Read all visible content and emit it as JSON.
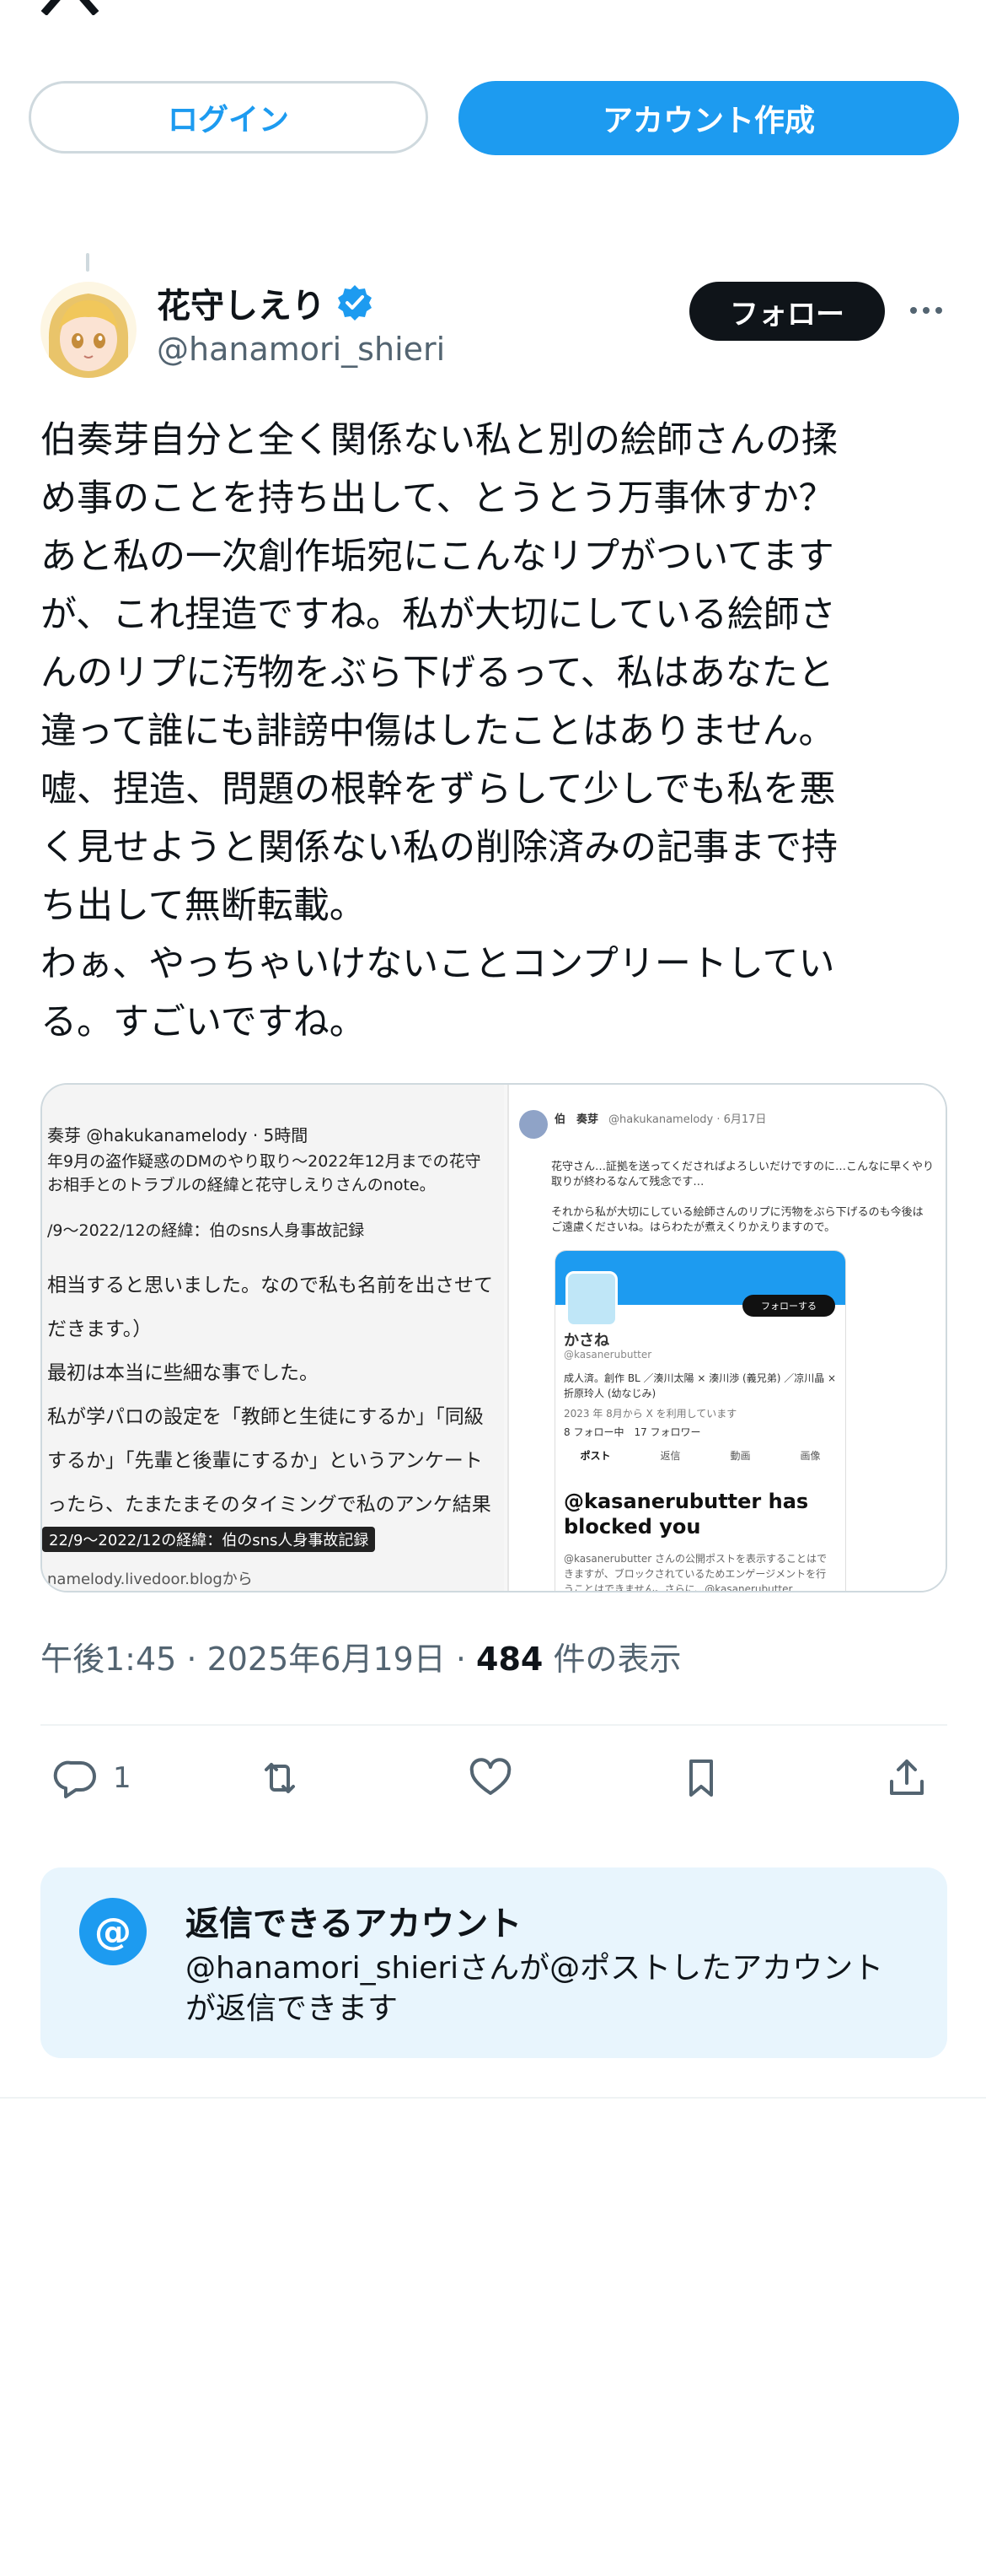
{
  "header": {
    "login_label": "ログイン",
    "create_account_label": "アカウント作成"
  },
  "tweet": {
    "display_name": "花守しえり",
    "handle": "@hanamori_shieri",
    "follow_label": "フォロー",
    "text": "伯奏芽自分と全く関係ない私と別の絵師さんの揉\nめ事のことを持ち出して、とうとう万事休すか？\nあと私の一次創作垢宛にこんなリプがついてます\nが、これ捏造ですね。私が大切にしている絵師さ\nんのリプに汚物をぶら下げるって、私はあなたと\n違って誰にも誹謗中傷はしたことはありません。\n嘘、捏造、問題の根幹をずらして少しでも私を悪\nく見せようと関係ない私の削除済みの記事まで持\nち出して無断転載。\nわぁ、やっちゃいけないことコンプリートしてい\nる。すごいですね。",
    "time": "午後1:45 · 2025年6月19日 · ",
    "views_count": "484",
    "views_label": " 件の表示",
    "reply_count": "1"
  },
  "media": {
    "left": {
      "header": "奏芽 @hakukanamelody · 5時間",
      "line1": "年9月の盗作疑惑のDMのやり取り～2022年12月までの花守",
      "line2": "お相手とのトラブルの経緯と花守しえりさんのnote。",
      "line3": "/9～2022/12の経緯：伯のsns人身事故記録",
      "body1": "相当すると思いました。なので私も名前を出させて",
      "body2": "だきます。）",
      "body3": "最初は本当に些細な事でした。",
      "body4": "私が学パロの設定を「教師と生徒にするか」「同級",
      "body5": "するか」「先輩と後輩にするか」というアンケート",
      "body6": "ったら、たまたまそのタイミングで私のアンケ結果",
      "caption": "22/9～2022/12の経緯：伯のsns人身事故記録",
      "source": "namelody.livedoor.blogから"
    },
    "right": {
      "header_name": "伯　奏芽",
      "header_handle": "@hakukanamelody · 6月17日",
      "reply_line1": "花守さん…証拠を送ってくださればよろしいだけですのに…こんなに早くやり",
      "reply_line2": "取りが終わるなんて残念です…",
      "reply_line3": "それから私が大切にしている絵師さんのリプに汚物をぶら下げるのも今後は",
      "reply_line4": "ご遠慮くださいね。はらわたが煮えくりかえりますので。",
      "card_follow": "フォローする",
      "card_name": "かさね",
      "card_handle": "@kasanerubutter",
      "card_bio1": "成人済。創作 BL ／湊川太陽 × 湊川渉 (義兄弟) ／凉川晶 ×",
      "card_bio2": "折原玲人 (幼なじみ)",
      "card_joined": "2023 年 8月から X を利用しています",
      "card_following": "8 フォロー中　17 フォロワー",
      "tab_posts": "ポスト",
      "tab_replies": "返信",
      "tab_media": "動画",
      "tab_images": "画像",
      "blocked_title": "@kasanerubutter has blocked you",
      "blocked_desc": "@kasanerubutter さんの公開ポストを表示することはできますが、ブロックされているためエンゲージメントを行うことはできません。さらに、@kasanerubutter"
    }
  },
  "reply_restriction": {
    "title": "返信できるアカウント",
    "description": "@hanamori_shieriさんが@ポストしたアカウントが返信できます"
  },
  "colors": {
    "accent": "#1d9bf0",
    "text": "#0f1419",
    "muted": "#536471",
    "reply_box_bg": "#e8f5fd"
  }
}
